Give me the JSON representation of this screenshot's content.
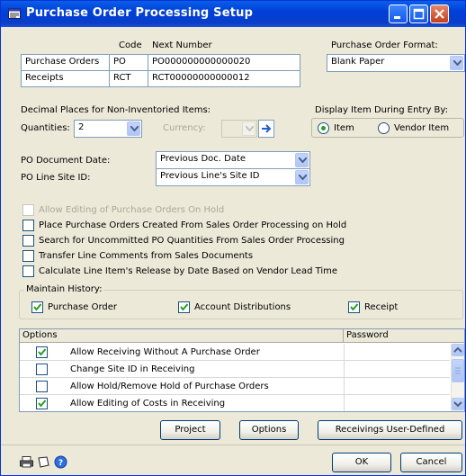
{
  "window": {
    "title": "Purchase Order Processing Setup"
  },
  "numbers": {
    "code_header": "Code",
    "next_number_header": "Next Number",
    "rows": [
      {
        "label": "Purchase Orders",
        "code": "PO",
        "next": "PO000000000000020"
      },
      {
        "label": "Receipts",
        "code": "RCT",
        "next": "RCT00000000000012"
      }
    ]
  },
  "po_format": {
    "label": "Purchase Order Format:",
    "value": "Blank Paper"
  },
  "decimals": {
    "title": "Decimal Places for Non-Inventoried Items:",
    "quantities_label": "Quantities:",
    "quantities_value": "2",
    "currency_label": "Currency:"
  },
  "display_item": {
    "title": "Display Item During Entry By:",
    "options": [
      "Item",
      "Vendor Item"
    ],
    "selected": "Item"
  },
  "po_document_date": {
    "label": "PO Document Date:",
    "value": "Previous Doc. Date"
  },
  "po_line_site": {
    "label": "PO Line Site ID:",
    "value": "Previous Line's Site ID"
  },
  "checks": [
    {
      "label": "Allow Editing of Purchase Orders On Hold",
      "checked": false,
      "disabled": true
    },
    {
      "label": "Place Purchase Orders Created From Sales Order Processing on Hold",
      "checked": false,
      "disabled": false
    },
    {
      "label": "Search for Uncommitted PO Quantities From Sales Order Processing",
      "checked": false,
      "disabled": false
    },
    {
      "label": "Transfer Line Comments from Sales Documents",
      "checked": false,
      "disabled": false
    },
    {
      "label": "Calculate Line Item's Release by Date Based on Vendor Lead Time",
      "checked": false,
      "disabled": false
    }
  ],
  "history": {
    "title": "Maintain History:",
    "items": [
      {
        "label": "Purchase Order",
        "checked": true
      },
      {
        "label": "Account Distributions",
        "checked": true
      },
      {
        "label": "Receipt",
        "checked": true
      }
    ]
  },
  "options_grid": {
    "headers": {
      "options": "Options",
      "password": "Password"
    },
    "rows": [
      {
        "label": "Allow Receiving Without A Purchase Order",
        "checked": true,
        "password": ""
      },
      {
        "label": "Change Site ID in Receiving",
        "checked": false,
        "password": ""
      },
      {
        "label": "Allow Hold/Remove Hold of Purchase Orders",
        "checked": false,
        "password": ""
      },
      {
        "label": "Allow Editing of Costs in Receiving",
        "checked": true,
        "password": ""
      }
    ]
  },
  "buttons": {
    "project": "Project",
    "options": "Options",
    "receivings_user_defined": "Receivings User-Defined",
    "ok": "OK",
    "cancel": "Cancel"
  },
  "colors": {
    "titlebar": "#0a3ec9",
    "check": "#21a121",
    "window_bg": "#ece9d8"
  }
}
